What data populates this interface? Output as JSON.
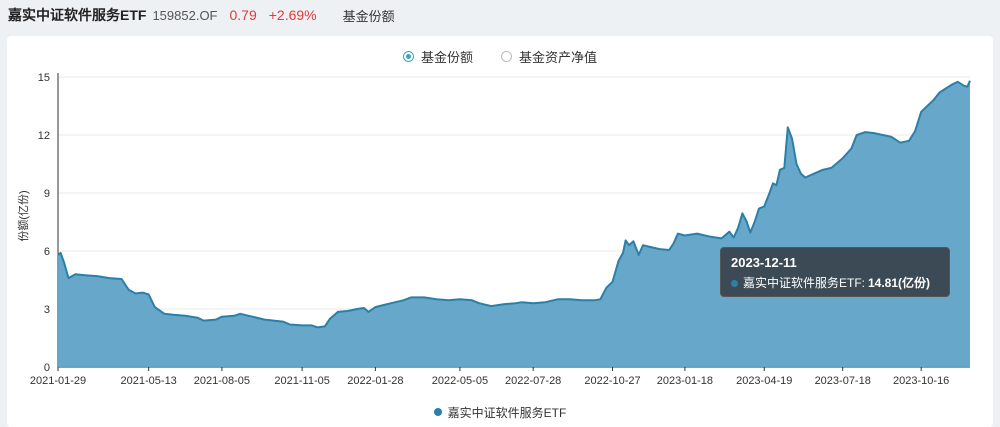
{
  "header": {
    "fund_name": "嘉实中证软件服务ETF",
    "fund_code": "159852.OF",
    "price": "0.79",
    "change": "+2.69%",
    "metric_label": "基金份额"
  },
  "toggles": [
    {
      "label": "基金份额",
      "selected": true
    },
    {
      "label": "基金资产净值",
      "selected": false
    }
  ],
  "tooltip": {
    "date": "2023-12-11",
    "series_name": "嘉实中证软件服务ETF:",
    "value": "14.81(亿份)"
  },
  "colors": {
    "line": "#2b7fa8",
    "area": "#5fa3c7",
    "up": "#e0393e",
    "toggle_on": "#3aa6b9"
  },
  "chart_data": {
    "type": "area",
    "ylabel": "份额(亿份)",
    "ylim": [
      0,
      15
    ],
    "yticks": [
      0,
      3,
      6,
      9,
      12,
      15
    ],
    "xlim": [
      "2021-01-29",
      "2023-12-11"
    ],
    "xticks": [
      "2021-01-29",
      "2021-05-13",
      "2021-08-05",
      "2021-11-05",
      "2022-01-28",
      "2022-05-05",
      "2022-07-28",
      "2022-10-27",
      "2023-01-18",
      "2023-04-19",
      "2023-07-18",
      "2023-10-16"
    ],
    "grid": true,
    "legend_position": "bottom",
    "series": [
      {
        "name": "嘉实中证软件服务ETF",
        "points": [
          [
            "2021-01-29",
            5.8
          ],
          [
            "2021-02-01",
            5.9
          ],
          [
            "2021-02-05",
            5.4
          ],
          [
            "2021-02-10",
            4.6
          ],
          [
            "2021-02-18",
            4.8
          ],
          [
            "2021-03-01",
            4.75
          ],
          [
            "2021-03-15",
            4.7
          ],
          [
            "2021-03-29",
            4.6
          ],
          [
            "2021-04-12",
            4.55
          ],
          [
            "2021-04-20",
            4.0
          ],
          [
            "2021-04-28",
            3.8
          ],
          [
            "2021-05-06",
            3.85
          ],
          [
            "2021-05-13",
            3.75
          ],
          [
            "2021-05-20",
            3.1
          ],
          [
            "2021-05-31",
            2.75
          ],
          [
            "2021-06-10",
            2.7
          ],
          [
            "2021-06-24",
            2.65
          ],
          [
            "2021-07-08",
            2.55
          ],
          [
            "2021-07-15",
            2.4
          ],
          [
            "2021-07-29",
            2.45
          ],
          [
            "2021-08-05",
            2.6
          ],
          [
            "2021-08-19",
            2.65
          ],
          [
            "2021-08-26",
            2.75
          ],
          [
            "2021-09-09",
            2.6
          ],
          [
            "2021-09-23",
            2.45
          ],
          [
            "2021-10-14",
            2.35
          ],
          [
            "2021-10-22",
            2.2
          ],
          [
            "2021-11-05",
            2.15
          ],
          [
            "2021-11-16",
            2.15
          ],
          [
            "2021-11-23",
            2.05
          ],
          [
            "2021-12-01",
            2.1
          ],
          [
            "2021-12-07",
            2.5
          ],
          [
            "2021-12-16",
            2.85
          ],
          [
            "2021-12-28",
            2.9
          ],
          [
            "2022-01-07",
            3.0
          ],
          [
            "2022-01-15",
            3.05
          ],
          [
            "2022-01-20",
            2.85
          ],
          [
            "2022-01-28",
            3.1
          ],
          [
            "2022-02-15",
            3.3
          ],
          [
            "2022-03-01",
            3.45
          ],
          [
            "2022-03-10",
            3.6
          ],
          [
            "2022-03-25",
            3.6
          ],
          [
            "2022-04-08",
            3.5
          ],
          [
            "2022-04-22",
            3.45
          ],
          [
            "2022-05-05",
            3.5
          ],
          [
            "2022-05-19",
            3.45
          ],
          [
            "2022-05-27",
            3.3
          ],
          [
            "2022-06-10",
            3.15
          ],
          [
            "2022-06-24",
            3.25
          ],
          [
            "2022-07-08",
            3.3
          ],
          [
            "2022-07-15",
            3.35
          ],
          [
            "2022-07-28",
            3.3
          ],
          [
            "2022-08-11",
            3.35
          ],
          [
            "2022-08-25",
            3.5
          ],
          [
            "2022-09-08",
            3.5
          ],
          [
            "2022-09-22",
            3.45
          ],
          [
            "2022-10-06",
            3.45
          ],
          [
            "2022-10-13",
            3.5
          ],
          [
            "2022-10-20",
            4.1
          ],
          [
            "2022-10-27",
            4.4
          ],
          [
            "2022-11-03",
            5.5
          ],
          [
            "2022-11-08",
            5.9
          ],
          [
            "2022-11-11",
            6.55
          ],
          [
            "2022-11-15",
            6.3
          ],
          [
            "2022-11-20",
            6.5
          ],
          [
            "2022-11-26",
            5.8
          ],
          [
            "2022-12-01",
            6.3
          ],
          [
            "2022-12-10",
            6.2
          ],
          [
            "2022-12-20",
            6.1
          ],
          [
            "2022-12-31",
            6.05
          ],
          [
            "2023-01-05",
            6.4
          ],
          [
            "2023-01-10",
            6.9
          ],
          [
            "2023-01-18",
            6.8
          ],
          [
            "2023-02-01",
            6.9
          ],
          [
            "2023-02-15",
            6.75
          ],
          [
            "2023-03-01",
            6.65
          ],
          [
            "2023-03-10",
            7.0
          ],
          [
            "2023-03-15",
            6.7
          ],
          [
            "2023-03-20",
            7.2
          ],
          [
            "2023-03-25",
            7.95
          ],
          [
            "2023-03-30",
            7.5
          ],
          [
            "2023-04-03",
            6.95
          ],
          [
            "2023-04-08",
            7.5
          ],
          [
            "2023-04-13",
            8.2
          ],
          [
            "2023-04-19",
            8.3
          ],
          [
            "2023-04-25",
            9.0
          ],
          [
            "2023-04-29",
            9.5
          ],
          [
            "2023-05-03",
            9.4
          ],
          [
            "2023-05-07",
            10.2
          ],
          [
            "2023-05-12",
            10.3
          ],
          [
            "2023-05-16",
            12.4
          ],
          [
            "2023-05-21",
            11.8
          ],
          [
            "2023-05-26",
            10.5
          ],
          [
            "2023-05-31",
            10.0
          ],
          [
            "2023-06-05",
            9.8
          ],
          [
            "2023-06-15",
            10.0
          ],
          [
            "2023-06-25",
            10.2
          ],
          [
            "2023-07-05",
            10.3
          ],
          [
            "2023-07-18",
            10.8
          ],
          [
            "2023-07-28",
            11.3
          ],
          [
            "2023-08-03",
            12.0
          ],
          [
            "2023-08-13",
            12.15
          ],
          [
            "2023-08-23",
            12.1
          ],
          [
            "2023-09-02",
            12.0
          ],
          [
            "2023-09-12",
            11.9
          ],
          [
            "2023-09-22",
            11.6
          ],
          [
            "2023-10-02",
            11.7
          ],
          [
            "2023-10-09",
            12.2
          ],
          [
            "2023-10-16",
            13.2
          ],
          [
            "2023-10-23",
            13.5
          ],
          [
            "2023-10-30",
            13.8
          ],
          [
            "2023-11-06",
            14.2
          ],
          [
            "2023-11-13",
            14.4
          ],
          [
            "2023-11-20",
            14.6
          ],
          [
            "2023-11-27",
            14.75
          ],
          [
            "2023-12-04",
            14.55
          ],
          [
            "2023-12-08",
            14.5
          ],
          [
            "2023-12-11",
            14.81
          ]
        ]
      }
    ]
  }
}
